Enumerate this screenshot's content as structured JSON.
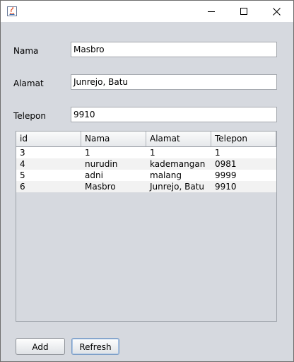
{
  "window": {
    "title": "",
    "controls": {
      "minimize": "minimize-icon",
      "maximize": "maximize-icon",
      "close": "close-icon"
    }
  },
  "form": {
    "nama": {
      "label": "Nama",
      "value": "Masbro"
    },
    "alamat": {
      "label": "Alamat",
      "value": "Junrejo, Batu"
    },
    "telepon": {
      "label": "Telepon",
      "value": "9910"
    }
  },
  "table": {
    "columns": [
      "id",
      "Nama",
      "Alamat",
      "Telepon"
    ],
    "rows": [
      [
        "3",
        "1",
        "1",
        "1"
      ],
      [
        "4",
        "nurudin",
        "kademangan",
        "0981"
      ],
      [
        "5",
        "adni",
        "malang",
        "9999"
      ],
      [
        "6",
        "Masbro",
        "Junrejo, Batu",
        "9910"
      ]
    ]
  },
  "buttons": {
    "add": "Add",
    "refresh": "Refresh"
  },
  "colors": {
    "background": "#d6d9df",
    "field": "#ffffff",
    "header": "#eceef0"
  }
}
